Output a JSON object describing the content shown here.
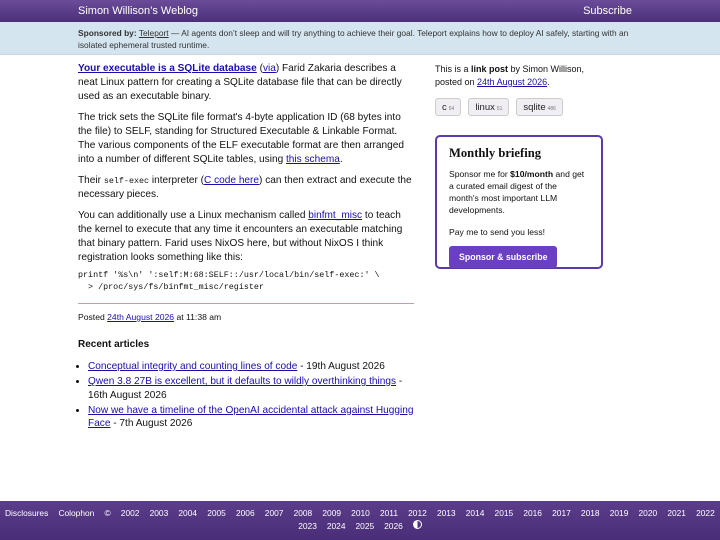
{
  "header": {
    "site_title": "Simon Willison’s Weblog",
    "subscribe": "Subscribe"
  },
  "sponsor": {
    "label": "Sponsored by:",
    "name": "Teleport",
    "text": " — AI agents don’t sleep and will try anything to achieve their goal. Teleport explains how to deploy AI safely, starting with an isolated ephemeral trusted runtime."
  },
  "post": {
    "title": "Your executable is a SQLite database",
    "via_open": " (",
    "via": "via",
    "via_close": ") Farid Zakaria describes a neat Linux pattern for creating a SQLite database file that can be directly used as an executable binary.",
    "p2_text": "The trick sets the SQLite file format's 4-byte application ID (68 bytes into the file) to SELF, standing for Structured Executable & Linkable Format. The various components of the ELF executable format are then arranged into a number of different SQLite tables, using ",
    "p2_link": "this schema",
    "p2_end": ".",
    "p3_start": "Their ",
    "p3_code": "self-exec",
    "p3_mid": " interpreter (",
    "p3_link": "C code here",
    "p3_end": ") can then extract and execute the necessary pieces.",
    "p4_start": "You can additionally use a Linux mechanism called ",
    "p4_link": "binfmt_misc",
    "p4_end": " to teach the kernel to execute that any time it encounters an executable matching that binary pattern. Farid uses NixOS here, but without NixOS I think registration looks something like this:",
    "code": "printf '%s\\n' ':self:M:68:SELF::/usr/local/bin/self-exec:' \\\n  > /proc/sys/fs/binfmt_misc/register",
    "posted_label": "Posted ",
    "posted_date": "24th August 2026",
    "posted_time": " at 11:38 am"
  },
  "recent": {
    "heading": "Recent articles",
    "items": [
      {
        "title": "Conceptual integrity and counting lines of code",
        "date": " - 19th August 2026"
      },
      {
        "title": "Qwen 3.8 27B is excellent, but it defaults to wildly overthinking things",
        "date": " - 16th August 2026"
      },
      {
        "title": "Now we have a timeline of the OpenAI accidental attack against Hugging Face",
        "date": " - 7th August 2026"
      }
    ]
  },
  "sidebar": {
    "intro_a": "This is a ",
    "intro_b": "link post",
    "intro_c": " by Simon Willison, posted on ",
    "date": "24th August 2026",
    "intro_d": ".",
    "tags": [
      {
        "name": "c",
        "count": "54"
      },
      {
        "name": "linux",
        "count": "51"
      },
      {
        "name": "sqlite",
        "count": "486"
      }
    ]
  },
  "briefing": {
    "title": "Monthly briefing",
    "p1_a": "Sponsor me for ",
    "p1_price": "$10/month",
    "p1_b": " and get a curated email digest of the month's most important LLM developments.",
    "p2": "Pay me to send you less!",
    "button": "Sponsor & subscribe"
  },
  "footer": {
    "disclosures": "Disclosures",
    "colophon": "Colophon",
    "copyright": "©",
    "years_row1": [
      "2002",
      "2003",
      "2004",
      "2005",
      "2006",
      "2007",
      "2008",
      "2009",
      "2010",
      "2011",
      "2012",
      "2013",
      "2014",
      "2015",
      "2016",
      "2017",
      "2018",
      "2019",
      "2020",
      "2021",
      "2022"
    ],
    "years_row2": [
      "2023",
      "2024",
      "2025",
      "2026"
    ]
  }
}
